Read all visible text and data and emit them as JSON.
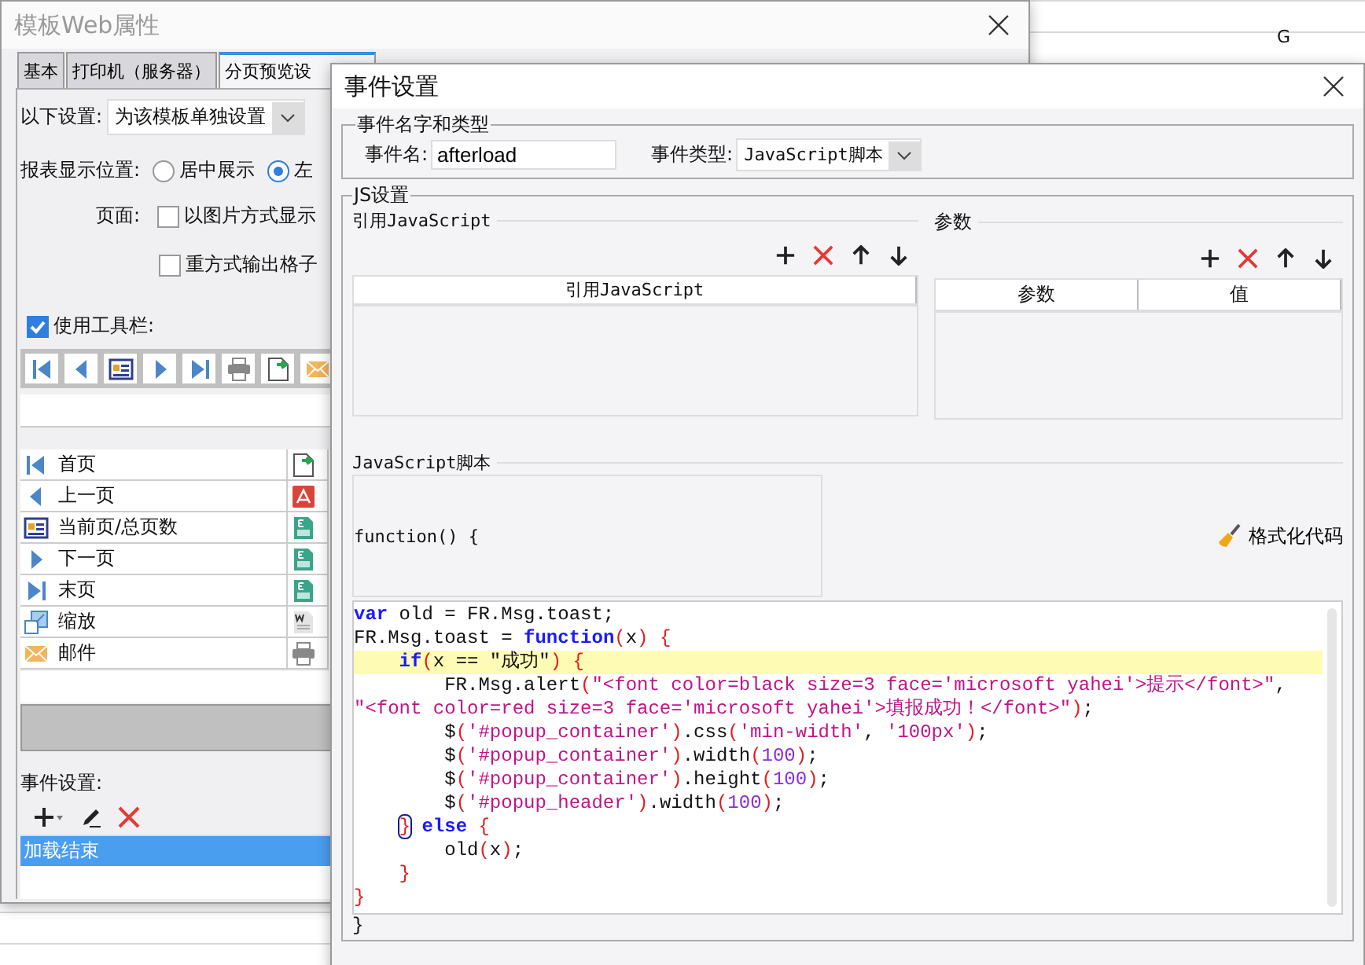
{
  "sheet": {
    "column_header": "G"
  },
  "template_dialog": {
    "title": "模板Web属性",
    "tabs": [
      {
        "label": "基本",
        "selected": false
      },
      {
        "label": "打印机（服务器）",
        "selected": false
      },
      {
        "label": "分页预览设",
        "selected": true
      }
    ],
    "following_setting": {
      "label": "以下设置:",
      "value": "为该模板单独设置"
    },
    "display_position": {
      "label": "报表显示位置:",
      "options": [
        {
          "label": "居中展示",
          "selected": false
        },
        {
          "label": "左",
          "selected": true
        }
      ]
    },
    "page": {
      "label": "页面:",
      "options": [
        {
          "label": "以图片方式显示",
          "checked": false
        },
        {
          "label": "重方式输出格子",
          "checked": false
        }
      ]
    },
    "use_toolbar": {
      "label": "使用工具栏:",
      "checked": true
    },
    "buttons": [
      {
        "label": "首页",
        "kind": "first"
      },
      {
        "label": "上一页",
        "kind": "prev"
      },
      {
        "label": "当前页/总页数",
        "kind": "page"
      },
      {
        "label": "下一页",
        "kind": "next"
      },
      {
        "label": "末页",
        "kind": "last"
      },
      {
        "label": "缩放",
        "kind": "zoom"
      },
      {
        "label": "邮件",
        "kind": "mail"
      }
    ],
    "export_buttons": [
      {
        "kind": "export"
      },
      {
        "kind": "pdf"
      },
      {
        "kind": "excel"
      },
      {
        "kind": "excel"
      },
      {
        "kind": "excel"
      },
      {
        "kind": "word"
      },
      {
        "kind": "print"
      }
    ],
    "events": {
      "label": "事件设置:",
      "items": [
        {
          "label": "加载结束",
          "selected": true
        }
      ]
    }
  },
  "event_dialog": {
    "title": "事件设置",
    "name_group": {
      "legend": "事件名字和类型",
      "name_label": "事件名:",
      "name_value": "afterload",
      "type_label": "事件类型:",
      "type_value": "JavaScript脚本"
    },
    "js_group": {
      "legend": "JS设置",
      "reference": {
        "title": "引用JavaScript",
        "columns": [
          "引用JavaScript"
        ]
      },
      "params": {
        "title": "参数",
        "columns": [
          "参数",
          "值"
        ]
      },
      "script_title": "JavaScript脚本",
      "function_open": "function() {",
      "format_button": "格式化代码",
      "code": [
        {
          "highlighted": false,
          "tokens": [
            {
              "text": "var",
              "kind": "kw"
            },
            {
              "text": " old = FR.Msg.toast;",
              "kind": "plain"
            }
          ]
        },
        {
          "highlighted": false,
          "tokens": [
            {
              "text": "FR.Msg.toast = ",
              "kind": "plain"
            },
            {
              "text": "function",
              "kind": "kw"
            },
            {
              "text": "(",
              "kind": "paren"
            },
            {
              "text": "x",
              "kind": "plain"
            },
            {
              "text": ") {",
              "kind": "paren"
            }
          ]
        },
        {
          "highlighted": true,
          "tokens": [
            {
              "text": "    if",
              "kind": "kw"
            },
            {
              "text": "(",
              "kind": "paren"
            },
            {
              "text": "x == \"成功\"",
              "kind": "plain"
            },
            {
              "text": ") {",
              "kind": "paren"
            }
          ]
        },
        {
          "highlighted": false,
          "tokens": [
            {
              "text": "        FR.Msg.alert",
              "kind": "plain"
            },
            {
              "text": "(",
              "kind": "paren"
            },
            {
              "text": "\"<font color=black size=3 face='microsoft yahei'>提示</font>\"",
              "kind": "str"
            },
            {
              "text": ",",
              "kind": "plain"
            }
          ]
        },
        {
          "highlighted": false,
          "tokens": [
            {
              "text": "\"<font color=red size=3 face='microsoft yahei'>填报成功！</font>\"",
              "kind": "str"
            },
            {
              "text": ")",
              "kind": "paren"
            },
            {
              "text": ";",
              "kind": "plain"
            }
          ]
        },
        {
          "highlighted": false,
          "tokens": [
            {
              "text": "        $",
              "kind": "plain"
            },
            {
              "text": "(",
              "kind": "paren"
            },
            {
              "text": "'#popup_container'",
              "kind": "str"
            },
            {
              "text": ")",
              "kind": "paren"
            },
            {
              "text": ".css",
              "kind": "plain"
            },
            {
              "text": "(",
              "kind": "paren"
            },
            {
              "text": "'min-width'",
              "kind": "str"
            },
            {
              "text": ", ",
              "kind": "plain"
            },
            {
              "text": "'100px'",
              "kind": "str"
            },
            {
              "text": ")",
              "kind": "paren"
            },
            {
              "text": ";",
              "kind": "plain"
            }
          ]
        },
        {
          "highlighted": false,
          "tokens": [
            {
              "text": "        $",
              "kind": "plain"
            },
            {
              "text": "(",
              "kind": "paren"
            },
            {
              "text": "'#popup_container'",
              "kind": "str"
            },
            {
              "text": ")",
              "kind": "paren"
            },
            {
              "text": ".width",
              "kind": "plain"
            },
            {
              "text": "(",
              "kind": "paren"
            },
            {
              "text": "100",
              "kind": "num"
            },
            {
              "text": ")",
              "kind": "paren"
            },
            {
              "text": ";",
              "kind": "plain"
            }
          ]
        },
        {
          "highlighted": false,
          "tokens": [
            {
              "text": "        $",
              "kind": "plain"
            },
            {
              "text": "(",
              "kind": "paren"
            },
            {
              "text": "'#popup_container'",
              "kind": "str"
            },
            {
              "text": ")",
              "kind": "paren"
            },
            {
              "text": ".height",
              "kind": "plain"
            },
            {
              "text": "(",
              "kind": "paren"
            },
            {
              "text": "100",
              "kind": "num"
            },
            {
              "text": ")",
              "kind": "paren"
            },
            {
              "text": ";",
              "kind": "plain"
            }
          ]
        },
        {
          "highlighted": false,
          "tokens": [
            {
              "text": "        $",
              "kind": "plain"
            },
            {
              "text": "(",
              "kind": "paren"
            },
            {
              "text": "'#popup_header'",
              "kind": "str"
            },
            {
              "text": ")",
              "kind": "paren"
            },
            {
              "text": ".width",
              "kind": "plain"
            },
            {
              "text": "(",
              "kind": "paren"
            },
            {
              "text": "100",
              "kind": "num"
            },
            {
              "text": ")",
              "kind": "paren"
            },
            {
              "text": ";",
              "kind": "plain"
            }
          ]
        },
        {
          "highlighted": false,
          "tokens": [
            {
              "text": "    }",
              "kind": "match"
            },
            {
              "text": " else",
              "kind": "kw"
            },
            {
              "text": " {",
              "kind": "paren"
            }
          ]
        },
        {
          "highlighted": false,
          "tokens": [
            {
              "text": "        old",
              "kind": "plain"
            },
            {
              "text": "(",
              "kind": "paren"
            },
            {
              "text": "x",
              "kind": "plain"
            },
            {
              "text": ")",
              "kind": "paren"
            },
            {
              "text": ";",
              "kind": "plain"
            }
          ]
        },
        {
          "highlighted": false,
          "tokens": [
            {
              "text": "    }",
              "kind": "paren"
            }
          ]
        },
        {
          "highlighted": false,
          "tokens": [
            {
              "text": "}",
              "kind": "paren"
            }
          ]
        }
      ],
      "function_close": "}"
    }
  }
}
